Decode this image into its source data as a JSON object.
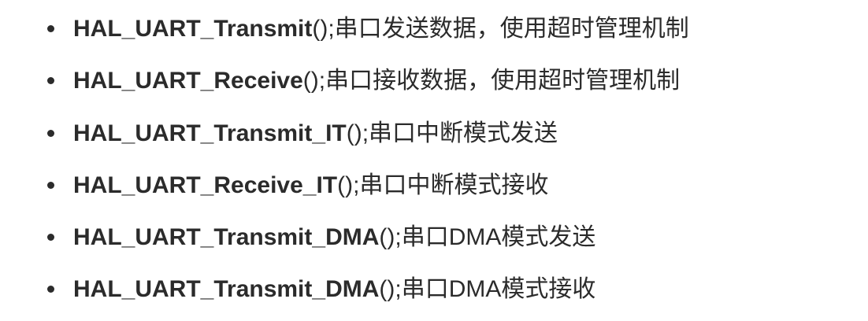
{
  "items": [
    {
      "name": "HAL_UART_Transmit",
      "rest": "();串口发送数据，使用超时管理机制"
    },
    {
      "name": "HAL_UART_Receive",
      "rest": "();串口接收数据，使用超时管理机制"
    },
    {
      "name": "HAL_UART_Transmit_IT",
      "rest": "();串口中断模式发送"
    },
    {
      "name": "HAL_UART_Receive_IT",
      "rest": "();串口中断模式接收"
    },
    {
      "name": "HAL_UART_Transmit_DMA",
      "rest": "();串口DMA模式发送"
    },
    {
      "name": "HAL_UART_Transmit_DMA",
      "rest": "();串口DMA模式接收"
    }
  ]
}
